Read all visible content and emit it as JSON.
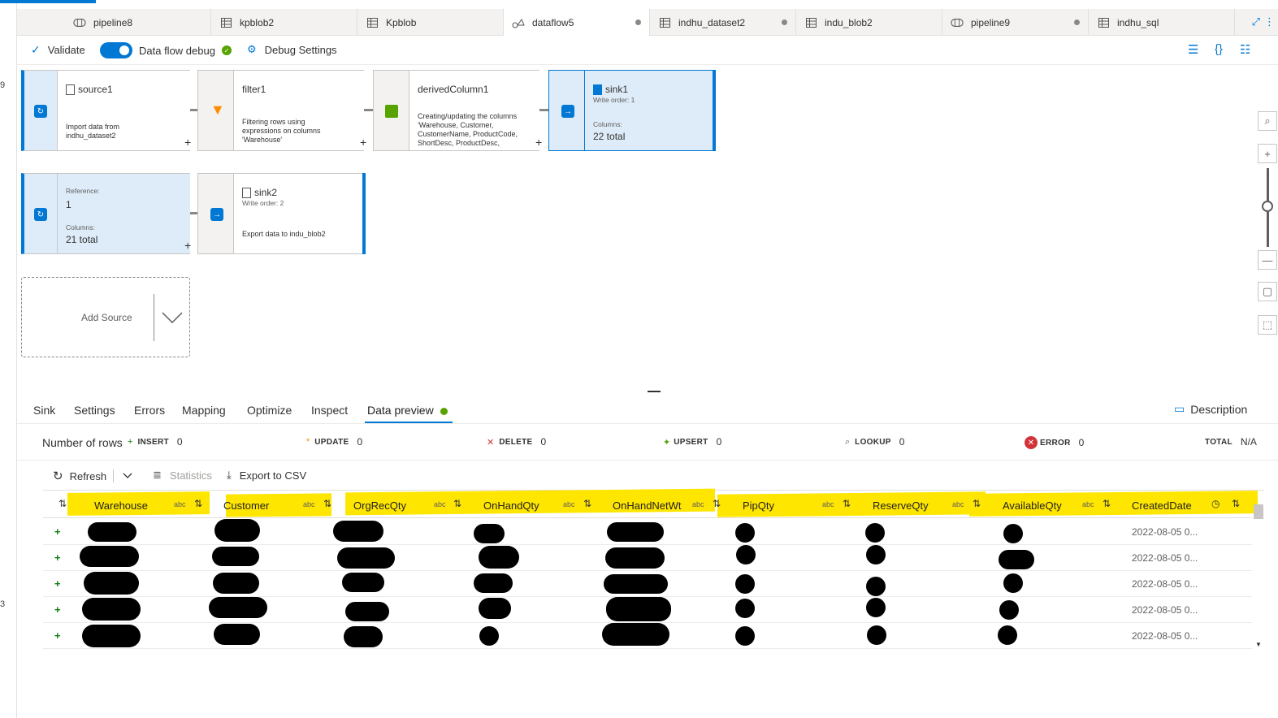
{
  "tabs": [
    {
      "label": "pipeline8",
      "icon": "pipeline-icon",
      "dot": false
    },
    {
      "label": "kpblob2",
      "icon": "table-icon",
      "dot": false
    },
    {
      "label": "Kpblob",
      "icon": "table-icon",
      "dot": false
    },
    {
      "label": "dataflow5",
      "icon": "dataflow-icon",
      "dot": true,
      "active": true
    },
    {
      "label": "indhu_dataset2",
      "icon": "table-icon",
      "dot": true
    },
    {
      "label": "indu_blob2",
      "icon": "table-icon",
      "dot": false
    },
    {
      "label": "pipeline9",
      "icon": "pipeline-icon",
      "dot": true
    },
    {
      "label": "indhu_sql",
      "icon": "table-icon",
      "dot": false
    }
  ],
  "toolbar": {
    "validate": "Validate",
    "debug_label": "Data flow debug",
    "debug_settings": "Debug Settings"
  },
  "nodes": {
    "source1": {
      "title": "source1",
      "desc": "Import data from\nindhu_dataset2"
    },
    "filter1": {
      "title": "filter1",
      "desc": "Filtering rows using\nexpressions on columns\n'Warehouse'"
    },
    "derived": {
      "title": "derivedColumn1",
      "desc": "Creating/updating the columns\n'Warehouse, Customer,\nCustomerName, ProductCode,\nShortDesc, ProductDesc,"
    },
    "sink1": {
      "title": "sink1",
      "order": "Write order: 1",
      "cols_label": "Columns:",
      "cols": "22 total"
    },
    "ref": {
      "ref_label": "Reference:",
      "ref": "1",
      "cols_label": "Columns:",
      "cols": "21 total"
    },
    "sink2": {
      "title": "sink2",
      "order": "Write order: 2",
      "desc": "Export data to indu_blob2"
    },
    "add_source": "Add Source"
  },
  "bottom_tabs": [
    "Sink",
    "Settings",
    "Errors",
    "Mapping",
    "Optimize",
    "Inspect",
    "Data preview"
  ],
  "description": "Description",
  "stats": {
    "rows_label": "Number of rows",
    "insert_label": "INSERT",
    "insert": "0",
    "update_label": "UPDATE",
    "update": "0",
    "delete_label": "DELETE",
    "delete": "0",
    "upsert_label": "UPSERT",
    "upsert": "0",
    "lookup_label": "LOOKUP",
    "lookup": "0",
    "error_label": "ERROR",
    "error": "0",
    "total_label": "TOTAL",
    "total": "N/A"
  },
  "actions": {
    "refresh": "Refresh",
    "statistics": "Statistics",
    "export": "Export to CSV"
  },
  "columns": [
    "Warehouse",
    "Customer",
    "OrgRecQty",
    "OnHandQty",
    "OnHandNetWt",
    "PipQty",
    "ReserveQty",
    "AvailableQty",
    "CreatedDate"
  ],
  "type_tag": "abc",
  "rows": [
    {
      "date": "2022-08-05 0..."
    },
    {
      "date": "2022-08-05 0..."
    },
    {
      "date": "2022-08-05 0..."
    },
    {
      "date": "2022-08-05 0..."
    },
    {
      "date": "2022-08-05 0..."
    }
  ],
  "left_strip": [
    "9",
    "3"
  ]
}
